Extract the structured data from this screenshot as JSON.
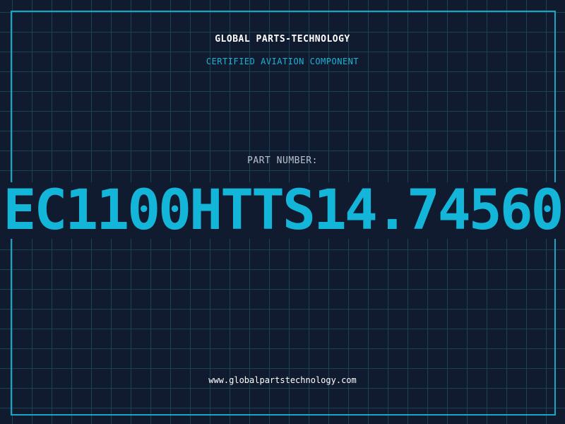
{
  "header": {
    "company": "GLOBAL PARTS-TECHNOLOGY",
    "subtitle": "CERTIFIED AVIATION COMPONENT"
  },
  "part": {
    "label": "PART NUMBER:",
    "number": "EC1100HTTS14.74560"
  },
  "footer": {
    "website": "www.globalpartstechnology.com"
  },
  "colors": {
    "background": "#111b30",
    "grid": "#1d4256",
    "accent": "#13b5d8",
    "text": "#ffffff"
  }
}
